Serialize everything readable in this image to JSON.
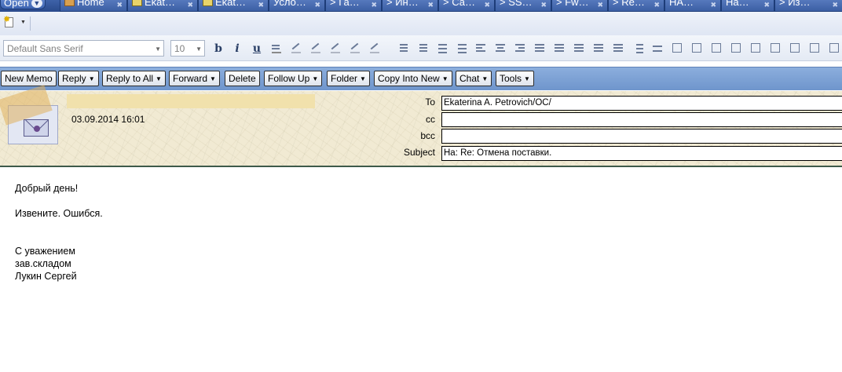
{
  "tabbar": {
    "open_label": "Open",
    "tabs": [
      {
        "label": "Home",
        "icon": "home-icon"
      },
      {
        "label": "Ekat…",
        "icon": "mail-icon"
      },
      {
        "label": "Ekat…",
        "icon": "mail-icon"
      },
      {
        "label": "Усло…",
        "icon": ""
      },
      {
        "label": "> Га…",
        "icon": ""
      },
      {
        "label": "> Ин…",
        "icon": ""
      },
      {
        "label": "> Са…",
        "icon": ""
      },
      {
        "label": "> SS…",
        "icon": ""
      },
      {
        "label": "> Fw…",
        "icon": ""
      },
      {
        "label": "> Re…",
        "icon": ""
      },
      {
        "label": "НА…",
        "icon": ""
      },
      {
        "label": "На…",
        "icon": ""
      },
      {
        "label": "> Из…",
        "icon": ""
      }
    ]
  },
  "format_toolbar": {
    "font_family": "Default Sans Serif",
    "font_size": "10",
    "bold": "b",
    "italic": "i",
    "underline": "u"
  },
  "commands": [
    {
      "label": "New Memo",
      "dropdown": false
    },
    {
      "label": "Reply",
      "dropdown": true
    },
    {
      "label": "Reply to All",
      "dropdown": true
    },
    {
      "label": "Forward",
      "dropdown": true
    },
    {
      "label": "Delete",
      "dropdown": false
    },
    {
      "label": "Follow Up",
      "dropdown": true
    },
    {
      "label": "Folder",
      "dropdown": true
    },
    {
      "label": "Copy Into New",
      "dropdown": true
    },
    {
      "label": "Chat",
      "dropdown": true
    },
    {
      "label": "Tools",
      "dropdown": true
    }
  ],
  "header": {
    "date": "03.09.2014 16:01",
    "to_label": "To",
    "to_value": "Ekaterina A. Petrovich/OC/",
    "cc_label": "cc",
    "cc_value": "",
    "bcc_label": "bcc",
    "bcc_value": "",
    "subject_label": "Subject",
    "subject_value": "На: Re: Отмена поставки."
  },
  "body": {
    "lines": [
      "Добрый день!",
      "",
      "Извените. Ошибся.",
      "",
      "",
      "С уважением",
      "зав.складом",
      "Лукин Сергей"
    ]
  }
}
